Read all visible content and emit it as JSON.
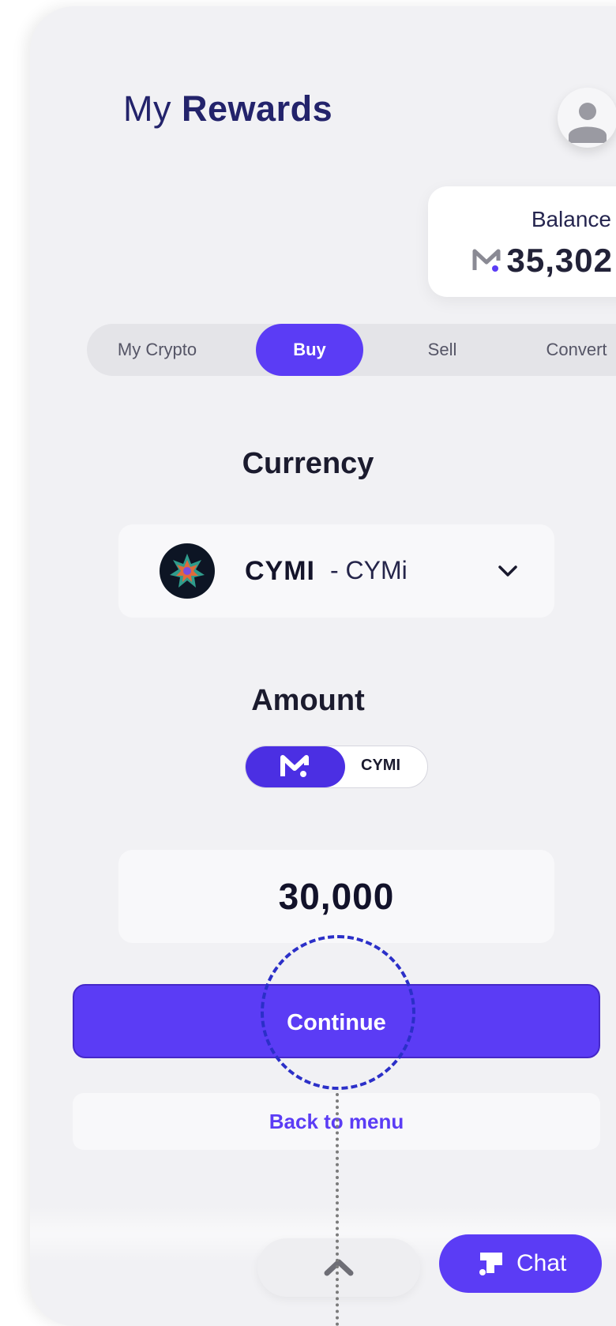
{
  "header": {
    "title_regular": "My",
    "title_bold": "Rewards",
    "avatar_icon": "user-avatar-icon"
  },
  "balance": {
    "label": "Balance",
    "value": "35,302",
    "icon": "m-token-icon"
  },
  "tabs": [
    {
      "label": "My Crypto",
      "active": false
    },
    {
      "label": "Buy",
      "active": true
    },
    {
      "label": "Sell",
      "active": false
    },
    {
      "label": "Convert",
      "active": false
    }
  ],
  "currency": {
    "heading": "Currency",
    "code": "CYMI",
    "separator": "-",
    "name": "CYMi",
    "icon": "cymi-coin-icon"
  },
  "amount": {
    "heading": "Amount",
    "toggle_options": [
      "M",
      "CYMI"
    ],
    "toggle_selected": "M",
    "value": "30,000"
  },
  "actions": {
    "continue_label": "Continue",
    "back_label": "Back to menu"
  },
  "floating": {
    "scroll_top_icon": "arrow-up-icon",
    "chat_label": "Chat",
    "chat_icon": "chat-icon"
  },
  "colors": {
    "accent": "#5b3cf5",
    "title": "#23236b",
    "annotation": "#2b2fc8"
  }
}
